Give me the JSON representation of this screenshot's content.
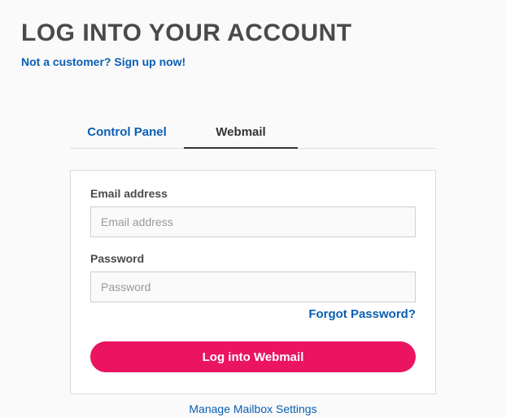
{
  "header": {
    "title": "LOG INTO YOUR ACCOUNT",
    "signup_link": "Not a customer? Sign up now!"
  },
  "tabs": [
    {
      "label": "Control Panel",
      "active": false
    },
    {
      "label": "Webmail",
      "active": true
    }
  ],
  "form": {
    "email": {
      "label": "Email address",
      "placeholder": "Email address",
      "value": ""
    },
    "password": {
      "label": "Password",
      "placeholder": "Password",
      "value": ""
    },
    "forgot_link": "Forgot Password?",
    "submit_label": "Log into Webmail"
  },
  "footer": {
    "manage_link": "Manage Mailbox Settings"
  },
  "colors": {
    "accent": "#ea1461",
    "link": "#0a5fb3"
  }
}
